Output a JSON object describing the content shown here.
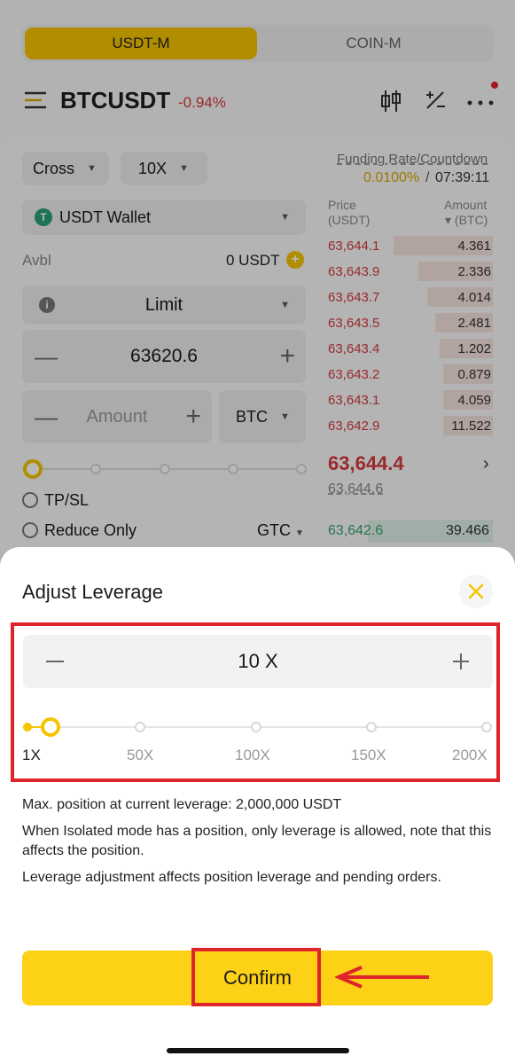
{
  "header": {
    "tabs": [
      "USDT-M",
      "COIN-M"
    ],
    "symbol": "BTCUSDT",
    "change": "-0.94%"
  },
  "order_form": {
    "margin_mode": "Cross",
    "leverage": "10X",
    "wallet": "USDT Wallet",
    "avbl_label": "Avbl",
    "avbl_value": "0 USDT",
    "order_type": "Limit",
    "price": "63620.6",
    "amount_placeholder": "Amount",
    "amount_unit": "BTC",
    "tpsl_label": "TP/SL",
    "reduce_only_label": "Reduce Only",
    "tif": "GTC"
  },
  "orderbook": {
    "funding_label": "Funding Rate/Countdown",
    "funding_rate": "0.0100%",
    "countdown": "07:39:11",
    "price_header": "Price",
    "price_unit": "(USDT)",
    "amount_header": "Amount",
    "amount_unit": "▾ (BTC)",
    "asks": [
      {
        "price": "63,644.1",
        "amount": "4.361",
        "depth": 0.6
      },
      {
        "price": "63,643.9",
        "amount": "2.336",
        "depth": 0.45
      },
      {
        "price": "63,643.7",
        "amount": "4.014",
        "depth": 0.4
      },
      {
        "price": "63,643.5",
        "amount": "2.481",
        "depth": 0.35
      },
      {
        "price": "63,643.4",
        "amount": "1.202",
        "depth": 0.32
      },
      {
        "price": "63,643.2",
        "amount": "0.879",
        "depth": 0.3
      },
      {
        "price": "63,643.1",
        "amount": "4.059",
        "depth": 0.3
      },
      {
        "price": "63,642.9",
        "amount": "11.522",
        "depth": 0.3
      }
    ],
    "last_price": "63,644.4",
    "mark_price": "63,644.6",
    "bid_price": "63,642.6",
    "bid_amount": "39.466"
  },
  "sheet": {
    "title": "Adjust Leverage",
    "value": "10 X",
    "ticks": [
      "1X",
      "50X",
      "100X",
      "150X",
      "200X"
    ],
    "slider_level": 0.045,
    "note1": "Max. position at current leverage: 2,000,000 USDT",
    "note2": "When Isolated mode has a position, only leverage is allowed, note that this affects the position.",
    "note3": "Leverage adjustment affects position leverage and pending orders.",
    "confirm_label": "Confirm"
  },
  "colors": {
    "accent": "#f5c400",
    "confirm": "#fcd116",
    "sell": "#d6393d",
    "buy": "#2ea672",
    "highlight": "#e0242b"
  }
}
